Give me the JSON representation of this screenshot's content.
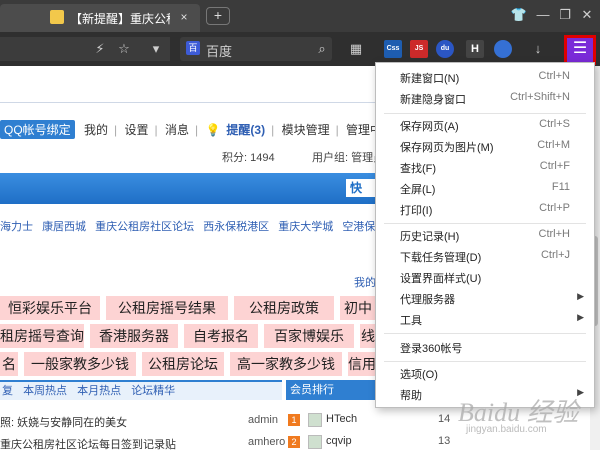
{
  "tabbar": {
    "tab_title": "【新提醒】重庆公租",
    "tab_close": "×",
    "new_tab": "+",
    "window_icons": [
      "shirt-icon",
      "minimize-icon",
      "restore-icon",
      "close-icon"
    ]
  },
  "toolbar": {
    "search_placeholder": "百度",
    "menu_glyph": "☰",
    "extensions": [
      {
        "name": "css",
        "text": "Css",
        "color": "#1e5db0"
      },
      {
        "name": "js",
        "text": "JS",
        "color": "#cc2a2a"
      },
      {
        "name": "du",
        "text": "du",
        "color": "#2b56c4"
      },
      {
        "name": "h",
        "text": "H",
        "color": "#444444"
      },
      {
        "name": "globe",
        "text": "",
        "color": "#3570d4"
      }
    ]
  },
  "page": {
    "userbar": {
      "qq_bind": "QQ帐号绑定",
      "mine": "我的",
      "settings": "设置",
      "messages": "消息",
      "remind": "提醒(3)",
      "module_manage": "模块管理",
      "manage_center": "管理中心"
    },
    "points_label": "积分: 1494",
    "group_label": "用户组: 管理员",
    "quick_label": "快",
    "links": [
      "海力士",
      "康居西城",
      "重庆公租房社区论坛",
      "西永保税港区",
      "重庆大学城",
      "空港保税区"
    ],
    "mine_link": "我的",
    "pink_rows": [
      [
        "恒彩娱乐平台",
        "公租房摇号结果",
        "公租房政策",
        "初中"
      ],
      [
        "租房摇号查询",
        "香港服务器",
        "自考报名",
        "百家博娱乐",
        "线"
      ],
      [
        "名",
        "一般家教多少钱",
        "公租房论坛",
        "高一家教多少钱",
        "信用"
      ]
    ],
    "sub_tabs": [
      "复",
      "本周热点",
      "本月热点",
      "论坛精华"
    ],
    "rank_title": "会员排行",
    "posts": [
      {
        "title": "照: 妖娆与安静同在的美女",
        "author": "admin"
      },
      {
        "title": "重庆公租房社区论坛每日签到记录贴",
        "author": "amhero"
      }
    ],
    "ranks": [
      {
        "num": "1",
        "name": "HTech",
        "count": "14"
      },
      {
        "num": "2",
        "name": "cqvip",
        "count": "13"
      }
    ]
  },
  "menu": {
    "groups": [
      [
        {
          "label": "新建窗口(N)",
          "shortcut": "Ctrl+N"
        },
        {
          "label": "新建隐身窗口",
          "shortcut": "Ctrl+Shift+N"
        }
      ],
      [
        {
          "label": "保存网页(A)",
          "shortcut": "Ctrl+S"
        },
        {
          "label": "保存网页为图片(M)",
          "shortcut": "Ctrl+M"
        },
        {
          "label": "查找(F)",
          "shortcut": "Ctrl+F"
        },
        {
          "label": "全屏(L)",
          "shortcut": "F11"
        },
        {
          "label": "打印(I)",
          "shortcut": "Ctrl+P"
        }
      ],
      [
        {
          "label": "历史记录(H)",
          "shortcut": "Ctrl+H"
        },
        {
          "label": "下载任务管理(D)",
          "shortcut": "Ctrl+J"
        },
        {
          "label": "设置界面样式(U)",
          "shortcut": ""
        },
        {
          "label": "代理服务器",
          "shortcut": "",
          "submenu": true
        },
        {
          "label": "工具",
          "shortcut": "",
          "submenu": true
        }
      ],
      [
        {
          "label": "登录360帐号",
          "shortcut": ""
        }
      ],
      [
        {
          "label": "选项(O)",
          "shortcut": ""
        },
        {
          "label": "帮助",
          "shortcut": "",
          "submenu": true
        }
      ]
    ]
  },
  "watermark": {
    "main": "Baidu 经验",
    "sub": "jingyan.baidu.com"
  }
}
